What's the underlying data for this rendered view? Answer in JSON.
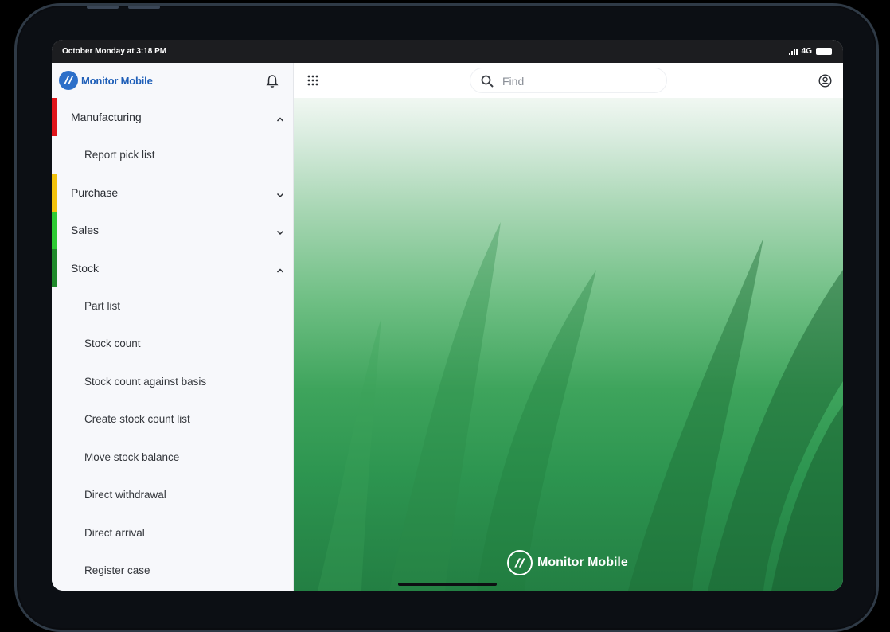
{
  "status_bar": {
    "time": "October Monday at 3:18 PM",
    "network": "4G"
  },
  "app": {
    "logo_text": "Monitor Mobile"
  },
  "colors": {
    "manufacturing": "#e0141a",
    "purchase": "#f2c20c",
    "sales": "#2dcb33",
    "stock": "#1f8a2a",
    "brand": "#2c6fc9"
  },
  "sidebar": {
    "items": [
      {
        "label": "Manufacturing",
        "type": "section",
        "expanded": true
      },
      {
        "label": "Report pick list",
        "type": "sub"
      },
      {
        "label": "Purchase",
        "type": "section",
        "expanded": false
      },
      {
        "label": "Sales",
        "type": "section",
        "expanded": false
      },
      {
        "label": "Stock",
        "type": "section",
        "expanded": true
      },
      {
        "label": "Part list",
        "type": "sub"
      },
      {
        "label": "Stock count",
        "type": "sub"
      },
      {
        "label": "Stock count against basis",
        "type": "sub"
      },
      {
        "label": "Create stock count list",
        "type": "sub"
      },
      {
        "label": "Move stock balance",
        "type": "sub"
      },
      {
        "label": "Direct withdrawal",
        "type": "sub"
      },
      {
        "label": "Direct arrival",
        "type": "sub"
      },
      {
        "label": "Register case",
        "type": "sub"
      }
    ]
  },
  "topbar": {
    "search_placeholder": "Find"
  },
  "icons": [
    "bell-icon",
    "apps-grid-icon",
    "search-icon",
    "account-icon",
    "chevron-up-icon",
    "chevron-down-icon"
  ]
}
